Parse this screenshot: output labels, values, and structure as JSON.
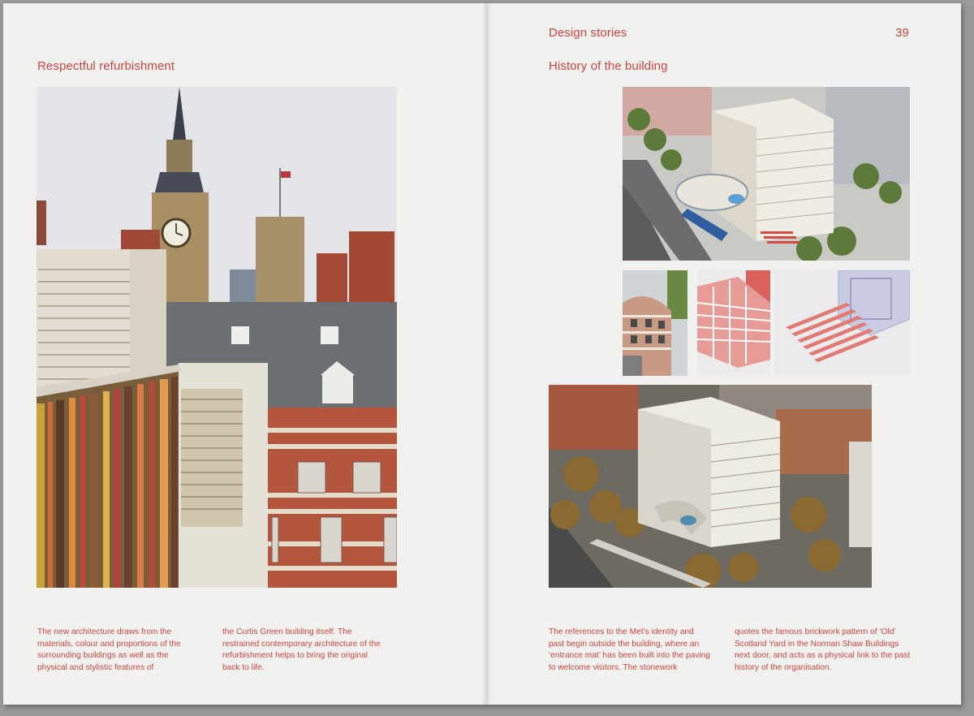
{
  "left_page": {
    "heading": "Respectful refurbishment",
    "text_col1": "The new architecture draws from the materials, colour and proportions of the surrounding buildings as well as the physical and stylistic features of",
    "text_col2": "the Curtis Green building itself. The restrained contemporary architecture of the refurbishment helps to bring the original back to life."
  },
  "right_page": {
    "section_title": "Design stories",
    "page_number": "39",
    "heading": "History of the building",
    "text_col1": "The references to the Met’s identity and past begin outside the building, where an ‘entrance mat’ has been built into the paving to welcome visitors. The stonework",
    "text_col2": "quotes the famous brickwork pattern of ‘Old’ Scotland Yard in the Norman Shaw Buildings next door, and acts as a physical link to the past history of the organisation."
  },
  "colors": {
    "accent_red": "#c8453f",
    "paper": "#f1f1ef",
    "background": "#9a9a9a"
  }
}
